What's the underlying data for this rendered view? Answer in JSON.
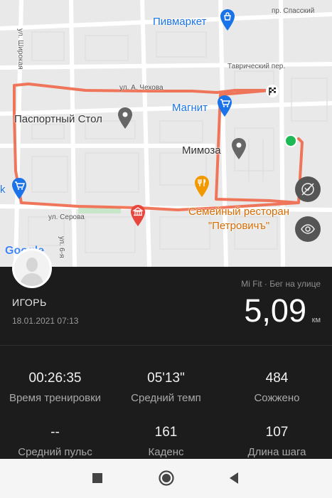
{
  "map": {
    "streets": {
      "spassky": "пр. Спасский",
      "shirokaya": "ул. Широкая",
      "chekhova": "ул. А. Чехова",
      "tavrichesky": "Таврический пер.",
      "serova": "ул. Серова",
      "ul6": "ул. 6-я"
    },
    "places": {
      "pivmarket": "Пивмаркет",
      "pasportny": "Паспортный Стол",
      "magnit": "Магнит",
      "mimoza": "Мимоза",
      "restaurant_line1": "Семейный ресторан",
      "restaurant_line2": "\"Петровичъ\"",
      "k": "k"
    },
    "google_logo": "Google",
    "colors": {
      "route": "#f0684a",
      "start": "#1db954",
      "pin_blue": "#1a73e8",
      "pin_gray": "#666666",
      "pin_orange": "#f29900",
      "pin_red": "#e8453c"
    }
  },
  "user": {
    "name": "ИГОРЬ",
    "date": "18.01.2021 07:13"
  },
  "workout": {
    "source": "Mi Fit · Бег на улице",
    "distance": "5,09",
    "distance_unit": "км"
  },
  "stats": [
    {
      "value": "00:26:35",
      "label": "Время тренировки"
    },
    {
      "value": "05'13\"",
      "label": "Средний темп"
    },
    {
      "value": "484",
      "label": "Сожжено"
    },
    {
      "value": "--",
      "label": "Средний пульс"
    },
    {
      "value": "161",
      "label": "Каденс"
    },
    {
      "value": "107",
      "label": "Длина шага"
    }
  ],
  "nav": {
    "icons": [
      "recents-square-icon",
      "home-circle-icon",
      "back-triangle-icon"
    ]
  }
}
